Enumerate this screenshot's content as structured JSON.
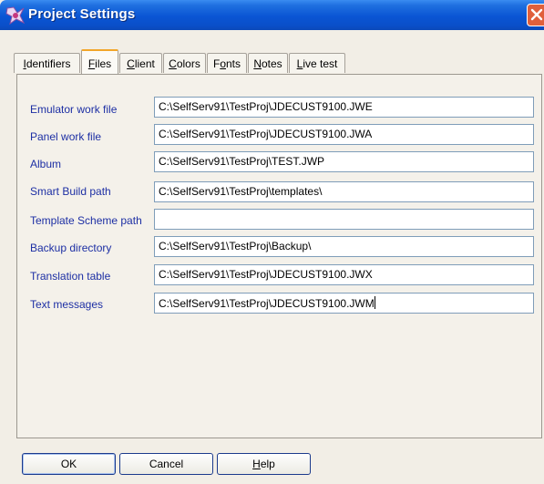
{
  "window": {
    "title": "Project Settings"
  },
  "tabs": [
    {
      "label": "Identifiers",
      "mnemonic": "I",
      "rest": "dentifiers"
    },
    {
      "label": "Files",
      "mnemonic": "F",
      "rest": "iles"
    },
    {
      "label": "Client",
      "mnemonic": "C",
      "rest": "lient"
    },
    {
      "label": "Colors",
      "mnemonic": "C",
      "rest": "olors"
    },
    {
      "label": "Fonts",
      "pre": "F",
      "mnemonic": "o",
      "rest": "nts"
    },
    {
      "label": "Notes",
      "mnemonic": "N",
      "rest": "otes"
    },
    {
      "label": "Live test",
      "mnemonic": "L",
      "rest": "ive test"
    }
  ],
  "active_tab": "Files",
  "files": [
    {
      "label": "Emulator work file",
      "value": "C:\\SelfServ91\\TestProj\\JDECUST9100.JWE"
    },
    {
      "label": "Panel work file",
      "value": "C:\\SelfServ91\\TestProj\\JDECUST9100.JWA"
    },
    {
      "label": "Album",
      "value": "C:\\SelfServ91\\TestProj\\TEST.JWP"
    },
    {
      "label": "Smart Build path",
      "value": "C:\\SelfServ91\\TestProj\\templates\\"
    },
    {
      "label": "Template Scheme path",
      "value": ""
    },
    {
      "label": "Backup directory",
      "value": "C:\\SelfServ91\\TestProj\\Backup\\"
    },
    {
      "label": "Translation table",
      "value": "C:\\SelfServ91\\TestProj\\JDECUST9100.JWX"
    },
    {
      "label": "Text messages",
      "value": "C:\\SelfServ91\\TestProj\\JDECUST9100.JWM"
    }
  ],
  "buttons": {
    "ok": "OK",
    "cancel": "Cancel",
    "help_mnemonic": "H",
    "help_rest": "elp"
  },
  "colors": {
    "title_bar": "#0a55d4",
    "label_text": "#1d2fa4",
    "close_button": "#e0603c"
  }
}
